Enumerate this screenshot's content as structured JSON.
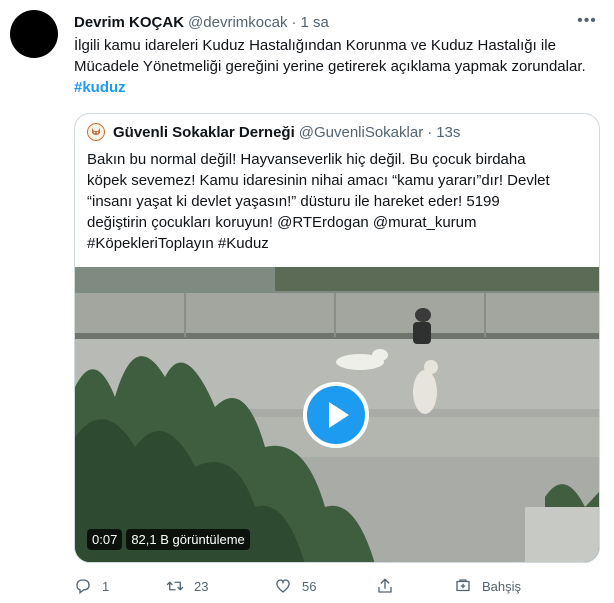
{
  "tweet": {
    "author_name": "Devrim KOÇAK",
    "author_handle": "@devrimkocak",
    "separator": "·",
    "time": "1 sa",
    "text": "İlgili kamu idareleri Kuduz Hastalığından Korunma ve Kuduz Hastalığı ile Mücadele Yönetmeliği gereğini yerine getirerek açıklama yapmak zorundalar.",
    "hashtag": "#kuduz"
  },
  "quote": {
    "author_name": "Güvenli Sokaklar Derneği",
    "author_handle": "@GuvenliSokaklar",
    "separator": "·",
    "time": "13s",
    "text_lines": [
      "Bakın bu normal değil! Hayvanseverlik hiç değil. Bu çocuk birdaha",
      "köpek sevemez! Kamu idaresinin nihai amacı “kamu yararı”dır!  Devlet",
      "“insanı yaşat ki devlet yaşasın!” düsturu ile hareket eder! 5199",
      "değiştirin çocukları koruyun! @RTErdogan @murat_kurum",
      "#KöpekleriToplayın #Kuduz"
    ],
    "video": {
      "duration": "0:07",
      "views": "82,1 B görüntüleme"
    }
  },
  "actions": {
    "reply_count": "1",
    "retweet_count": "23",
    "like_count": "56",
    "tip_label": "Bahşiş"
  },
  "icons": {
    "more": "more-icon",
    "reply": "reply-icon",
    "retweet": "retweet-icon",
    "like": "heart-icon",
    "share": "share-icon",
    "tip": "tip-icon",
    "play": "play-icon"
  },
  "colors": {
    "accent": "#1d9bf0",
    "text": "#0f1419",
    "muted": "#536471",
    "border": "#cfd9de"
  }
}
